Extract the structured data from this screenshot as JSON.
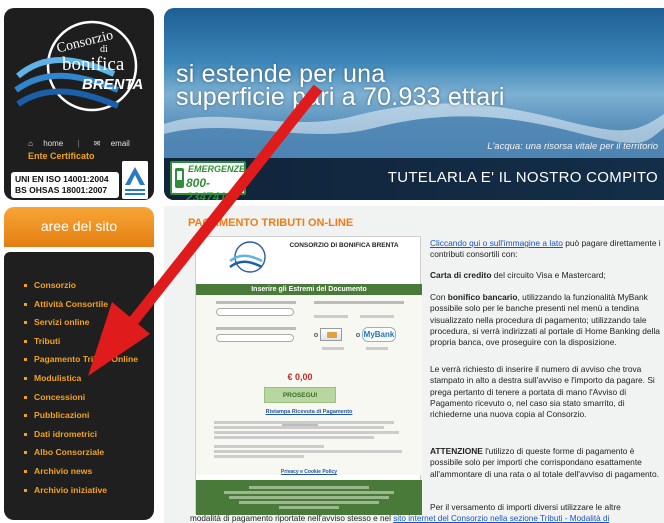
{
  "logo": {
    "line1": "Consorzio",
    "line2": "di",
    "line3": "bonifica",
    "line4": "BRENTA"
  },
  "toplinks": {
    "home": "home",
    "email": "email"
  },
  "ente_certificato": "Ente Certificato",
  "certifications": [
    "UNI EN ISO 14001:2004",
    "BS OHSAS 18001:2007"
  ],
  "aree_title": "aree del sito",
  "menu": [
    "Consorzio",
    "Attività Consortile",
    "Servizi online",
    "Tributi",
    "Pagamento Tributi Online",
    "Modulistica",
    "Concessioni",
    "Pubblicazioni",
    "Dati idrometrici",
    "Albo Consorziale",
    "Archivio news",
    "Archivio iniziative"
  ],
  "banner": {
    "headline_1": "si estende per una",
    "headline_2": "superficie pari a 70.933 ettari",
    "tagline": "L'acqua: una risorsa vitale per il territorio",
    "slogan": "TUTELARLA E' IL NOSTRO COMPITO",
    "emergency_label": "EMERGENZE",
    "emergency_number": "800-234741"
  },
  "page_title": "PAGAMENTO TRIBUTI ON-LINE",
  "payment_image": {
    "org": "CONSORZIO DI BONIFICA BRENTA",
    "bar": "Inserire gli Estremi del Documento",
    "amount": "€ 0,00",
    "button": "PROSEGUI",
    "link": "Ristampa Ricevuta di Pagamento",
    "privacy": "Privacy e Cookie Policy"
  },
  "right_text": {
    "p1_link": "Cliccando qui o sull'immagine a lato",
    "p1_rest": " può pagare direttamente i contributi consortili con:",
    "p2_bold": "Carta di credito",
    "p2_rest": " del circuito Visa e Mastercard;",
    "p3_a": "Con ",
    "p3_bold": "bonifico bancario",
    "p3_rest": ", utilizzando la funzionalità MyBank possibile solo per le banche presenti nel menù a tendina visualizzato nella procedura di pagamento; utilizzando tale procedura, si verrà indirizzati al portale di Home Banking della propria banca, ove proseguire con la disposizione.",
    "p4": "Le verrà richiesto di inserire il numero di avviso che trova stampato in alto a destra sull'avviso e l'importo da pagare. Si prega pertanto di tenere a portata di mano l'Avviso di Pagamento ricevuto o, nel caso sia stato smarrito, di richiederne una nuova copia al Consorzio.",
    "p5_bold": "ATTENZIONE",
    "p5_rest": " l'utilizzo di queste forme di pagamento è possibile solo per importi che corrispondano esattamente all'ammontare di una rata o al totale dell'avviso di pagamento.",
    "p6": "Per il versamento di importi diversi utilizzare le altre"
  },
  "bottom_line": {
    "a": "modalità di pagamento riportate nell'avviso stesso e nel ",
    "link": "sito internet del Consorzio nella sezione Tributi - Modalità di"
  },
  "colors": {
    "accent_orange": "#f3a21c",
    "title_orange": "#f07c13",
    "link_blue": "#1a55c5",
    "arrow_red": "#e01b1b",
    "emergency_green": "#2f8e3a"
  }
}
